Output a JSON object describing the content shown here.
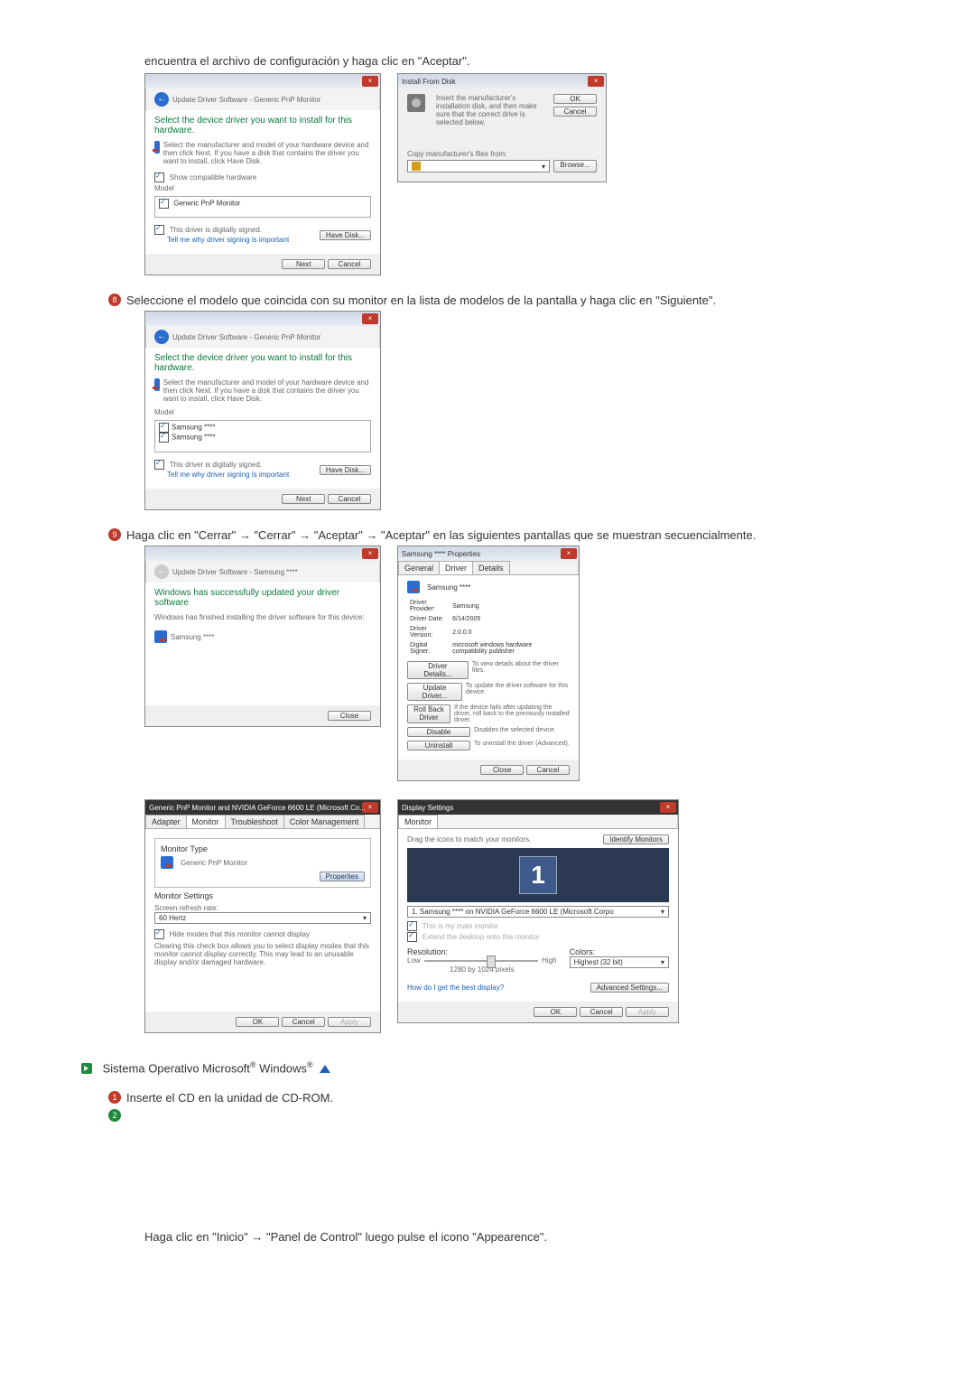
{
  "intro_text": "encuentra el archivo de configuración y haga clic en \"Aceptar\".",
  "dlg_update1": {
    "breadcrumb": "Update Driver Software - Generic PnP Monitor",
    "heading": "Select the device driver you want to install for this hardware.",
    "desc": "Select the manufacturer and model of your hardware device and then click Next. If you have a disk that contains the driver you want to install, click Have Disk.",
    "show_compat": "Show compatible hardware",
    "model_hdr": "Model",
    "model_item": "Generic PnP Monitor",
    "signed": "This driver is digitally signed.",
    "tell_me": "Tell me why driver signing is important",
    "have_disk": "Have Disk...",
    "next": "Next",
    "cancel": "Cancel"
  },
  "dlg_install_disk": {
    "title": "Install From Disk",
    "desc": "Insert the manufacturer's installation disk, and then make sure that the correct drive is selected below.",
    "ok": "OK",
    "cancel": "Cancel",
    "copy_from": "Copy manufacturer's files from:",
    "browse": "Browse..."
  },
  "step8": "Seleccione el modelo que coincida con su monitor en la lista de modelos de la pantalla y haga clic en \"Siguiente\".",
  "dlg_update2": {
    "breadcrumb": "Update Driver Software - Generic PnP Monitor",
    "heading": "Select the device driver you want to install for this hardware.",
    "desc": "Select the manufacturer and model of your hardware device and then click Next. If you have a disk that contains the driver you want to install, click Have Disk.",
    "model_hdr": "Model",
    "model1": "Samsung ****",
    "model2": "Samsung ****",
    "signed": "This driver is digitally signed.",
    "tell_me": "Tell me why driver signing is important",
    "have_disk": "Have Disk...",
    "next": "Next",
    "cancel": "Cancel"
  },
  "step9": "Haga clic en \"Cerrar\" → \"Cerrar\" → \"Aceptar\" → \"Aceptar\" en las siguientes pantallas que se muestran secuencialmente.",
  "dlg_success": {
    "breadcrumb": "Update Driver Software - Samsung ****",
    "heading": "Windows has successfully updated your driver software",
    "desc": "Windows has finished installing the driver software for this device:",
    "device": "Samsung ****",
    "close": "Close"
  },
  "dlg_props": {
    "title": "Samsung **** Properties",
    "tab_general": "General",
    "tab_driver": "Driver",
    "tab_details": "Details",
    "device_name": "Samsung ****",
    "lbl_provider": "Driver Provider:",
    "val_provider": "Samsung",
    "lbl_date": "Driver Date:",
    "val_date": "6/14/2005",
    "lbl_version": "Driver Version:",
    "val_version": "2.0.0.0",
    "lbl_signer": "Digital Signer:",
    "val_signer": "microsoft windows hardware compatibility publisher",
    "btn_details": "Driver Details...",
    "txt_details": "To view details about the driver files.",
    "btn_update": "Update Driver...",
    "txt_update": "To update the driver software for this device.",
    "btn_rollback": "Roll Back Driver",
    "txt_rollback": "If the device fails after updating the driver, roll back to the previously installed driver.",
    "btn_disable": "Disable",
    "txt_disable": "Disables the selected device.",
    "btn_uninstall": "Uninstall",
    "txt_uninstall": "To uninstall the driver (Advanced).",
    "close": "Close",
    "cancel": "Cancel"
  },
  "dlg_monitor": {
    "title": "Generic PnP Monitor and NVIDIA GeForce 6600 LE (Microsoft Co...",
    "tab_adapter": "Adapter",
    "tab_monitor": "Monitor",
    "tab_trouble": "Troubleshoot",
    "tab_color": "Color Management",
    "mt_hdr": "Monitor Type",
    "mt_name": "Generic PnP Monitor",
    "btn_properties": "Properties",
    "ms_hdr": "Monitor Settings",
    "refresh_lbl": "Screen refresh rate:",
    "refresh_val": "60 Hertz",
    "hide_modes": "Hide modes that this monitor cannot display",
    "hide_desc": "Clearing this check box allows you to select display modes that this monitor cannot display correctly. This may lead to an unusable display and/or damaged hardware.",
    "ok": "OK",
    "cancel": "Cancel",
    "apply": "Apply"
  },
  "dlg_display": {
    "title": "Display Settings",
    "tab_monitor": "Monitor",
    "drag": "Drag the icons to match your monitors.",
    "identify": "Identify Monitors",
    "combo": "1. Samsung **** on NVIDIA GeForce 6600 LE (Microsoft Corpo",
    "chk_main": "This is my main monitor",
    "chk_extend": "Extend the desktop onto this monitor",
    "res_lbl": "Resolution:",
    "res_low": "Low",
    "res_high": "High",
    "res_val": "1280 by 1024 pixels",
    "col_lbl": "Colors:",
    "col_val": "Highest (32 bit)",
    "best_link": "How do I get the best display?",
    "adv": "Advanced Settings...",
    "ok": "OK",
    "cancel": "Cancel",
    "apply": "Apply"
  },
  "os_line_pre": "Sistema Operativo Microsoft",
  "os_line_mid": " Windows",
  "step_xp1": "Inserte el CD en la unidad de CD-ROM.",
  "cp_line": "Haga clic en \"Inicio\" → \"Panel de Control\" luego pulse el icono \"Appearence\"."
}
